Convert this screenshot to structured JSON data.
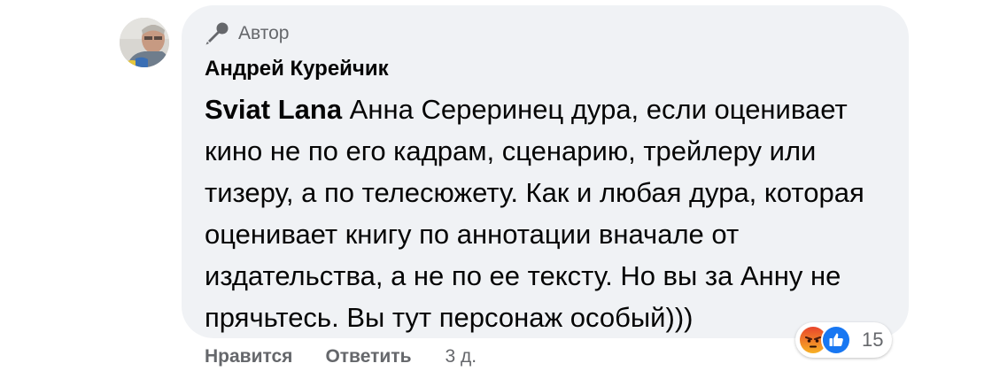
{
  "comment": {
    "badge_label": "Автор",
    "author_name": "Андрей Курейчик",
    "mention": "Sviat Lana",
    "text": " Анна Сереринец дура, если оценивает кино не по его кадрам, сценарию, трейлеру или тизеру, а по телесюжету. Как и любая дура, которая оценивает книгу по аннотации вначале от издательства, а не по ее тексту. Но вы за Анну не прячьтесь. Вы тут персонаж особый)))",
    "reactions": {
      "icons": [
        "angry-icon",
        "like-icon"
      ],
      "count": "15"
    },
    "actions": {
      "like_label": "Нравится",
      "reply_label": "Ответить",
      "timestamp": "3 д."
    }
  },
  "colors": {
    "bubble_bg": "#f0f2f5",
    "secondary_text": "#65676b",
    "primary_text": "#050505",
    "like_blue": "#1877f2",
    "angry_orange": "#f7774b"
  }
}
